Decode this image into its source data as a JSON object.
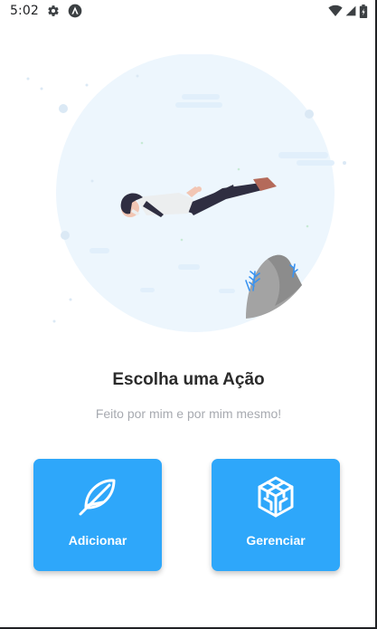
{
  "status_bar": {
    "time": "5:02",
    "icons": [
      "gear-icon",
      "accessibility-icon",
      "wifi-icon",
      "signal-icon",
      "battery-icon"
    ]
  },
  "hero": {
    "illustration": "man-flying-illustration"
  },
  "main": {
    "title": "Escolha uma Ação",
    "subtitle": "Feito por mim e por mim mesmo!"
  },
  "actions": [
    {
      "label": "Adicionar",
      "icon": "feather-icon"
    },
    {
      "label": "Gerenciar",
      "icon": "cube-icon"
    }
  ],
  "colors": {
    "accent": "#2ea7fa",
    "hero_circle": "#edf6fd",
    "title": "#2b2b2b",
    "subtitle": "#a7aab0"
  }
}
